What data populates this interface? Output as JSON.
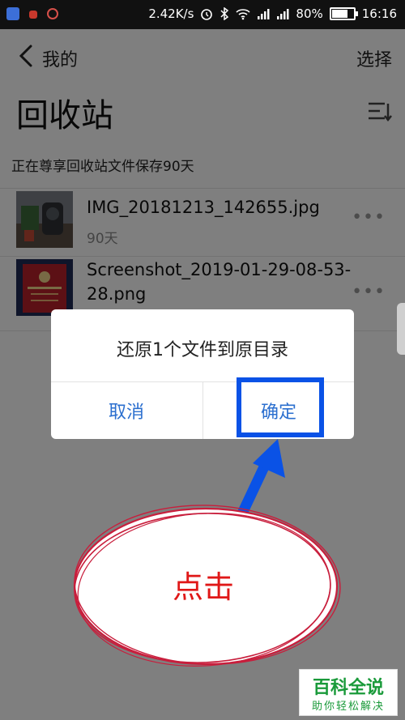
{
  "status_bar": {
    "network_speed": "2.42K/s",
    "battery": "80%",
    "battery_level": 0.8,
    "time": "16:16"
  },
  "header": {
    "back_label": "我的",
    "select_label": "选择",
    "title": "回收站"
  },
  "notice": "正在尊享回收站文件保存90天",
  "files": [
    {
      "name": "IMG_20181213_142655.jpg",
      "meta": "90天"
    },
    {
      "name": "Screenshot_2019-01-29-08-53-28.png",
      "meta": ""
    }
  ],
  "dialog": {
    "message": "还原1个文件到原目录",
    "cancel_label": "取消",
    "confirm_label": "确定"
  },
  "annotation": {
    "click_label": "点击"
  },
  "watermark": {
    "main": "百科全说",
    "sub": "助你轻松解决"
  },
  "colors": {
    "accent": "#2b6fcf",
    "highlight": "#0a52e6",
    "annotation_text": "#e01818",
    "watermark": "#1a9a3a"
  }
}
